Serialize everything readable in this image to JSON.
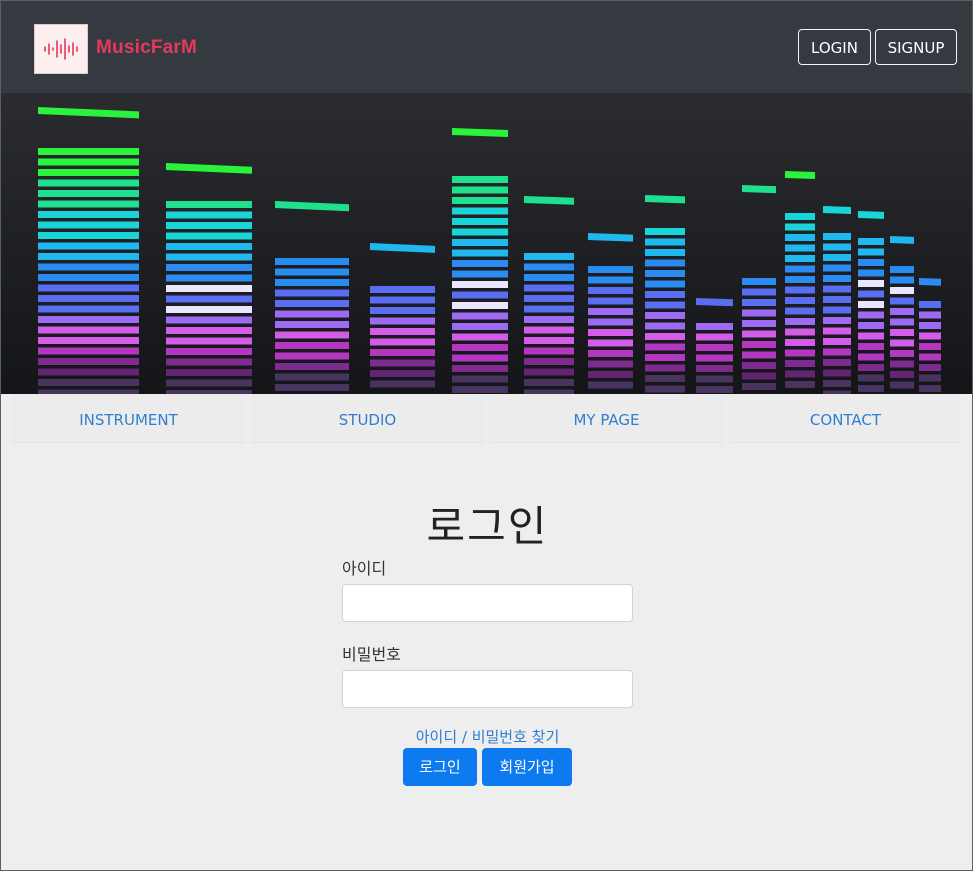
{
  "header": {
    "brand": "MusicFarM",
    "logo_icon": "sound-wave-icon",
    "login_label": "LOGIN",
    "signup_label": "SIGNUP"
  },
  "banner": {
    "image": "equalizer-bars-image"
  },
  "nav": {
    "items": [
      {
        "label": "INSTRUMENT"
      },
      {
        "label": "STUDIO"
      },
      {
        "label": "MY PAGE"
      },
      {
        "label": "CONTACT"
      }
    ]
  },
  "login": {
    "title": "로그인",
    "id_label": "아이디",
    "id_value": "",
    "password_label": "비밀번호",
    "password_value": "",
    "find_link": "아이디 / 비밀번호 찾기",
    "login_button": "로그인",
    "join_button": "회원가입"
  },
  "colors": {
    "header_bg": "#343a40",
    "brand": "#e33a5b",
    "link": "#2f7ed0",
    "primary_button": "#0d7bef",
    "page_bg": "#eeeeee"
  }
}
